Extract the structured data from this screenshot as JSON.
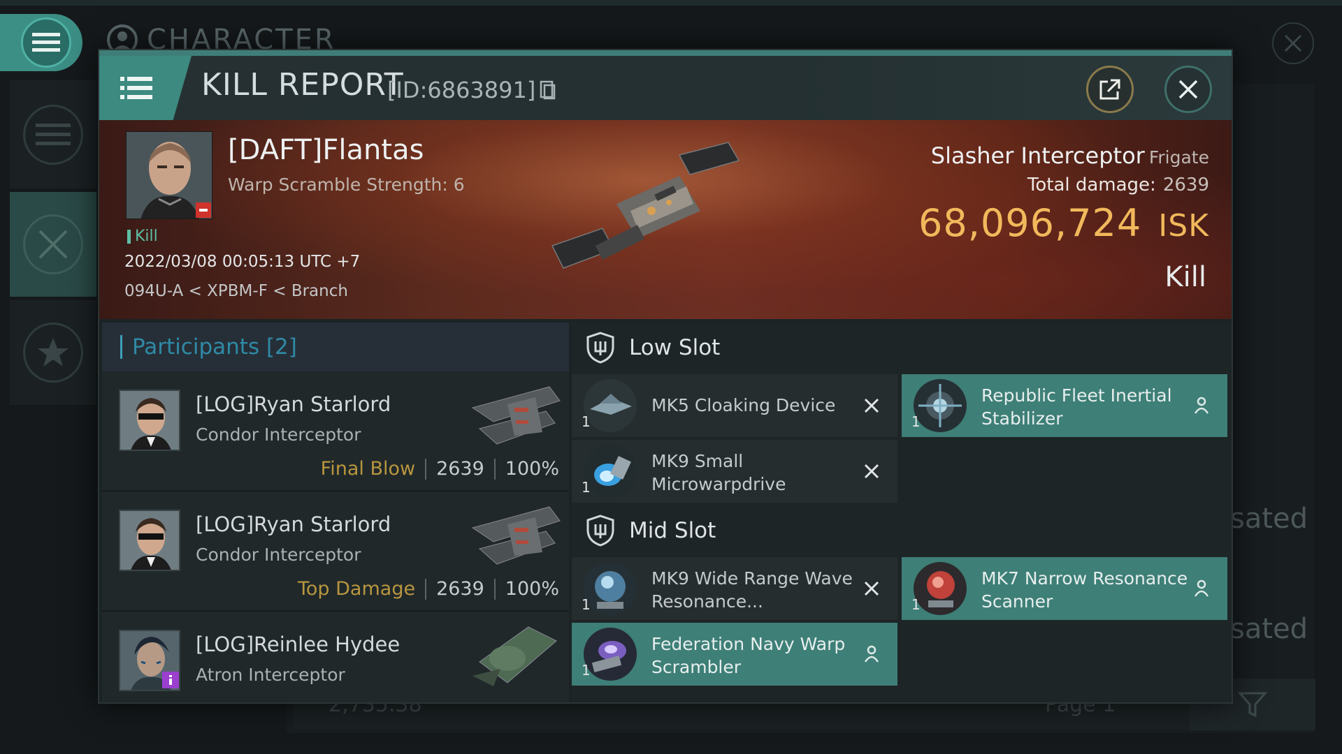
{
  "background": {
    "title": "CHARACTER",
    "sated_1": "sated",
    "sated_2": "sated",
    "balance": "2,735.38",
    "page": "Page 1"
  },
  "header": {
    "title": "KILL REPORT",
    "id_label": "[ID:6863891]",
    "icons": [
      "menu-icon",
      "copy-icon",
      "share-icon",
      "close-icon"
    ]
  },
  "victim": {
    "name": "[DAFT]Flantas",
    "warp_scramble": "Warp Scramble Strength: 6",
    "kill_tag": "Kill",
    "timestamp": "2022/03/08 00:05:13 UTC +7",
    "location": "094U-A < XPBM-F < Branch",
    "ship_name": "Slasher Interceptor",
    "ship_class": "Frigate",
    "damage_label": "Total damage:",
    "damage_value": "2639",
    "isk_value": "68,096,724",
    "isk_unit": "ISK",
    "result": "Kill"
  },
  "participants": {
    "title": "Participants [2]",
    "rows": [
      {
        "name": "[LOG]Ryan Starlord",
        "ship": "Condor Interceptor",
        "tag": "Final Blow",
        "damage": "2639",
        "percent": "100%"
      },
      {
        "name": "[LOG]Ryan Starlord",
        "ship": "Condor Interceptor",
        "tag": "Top Damage",
        "damage": "2639",
        "percent": "100%"
      },
      {
        "name": "[LOG]Reinlee Hydee",
        "ship": "Atron Interceptor",
        "tag": "",
        "damage": "",
        "percent": ""
      }
    ]
  },
  "fitting": {
    "low_slot_title": "Low Slot",
    "mid_slot_title": "Mid Slot",
    "items": [
      {
        "name": "MK5 Cloaking Device",
        "qty": "1",
        "status": "destroyed"
      },
      {
        "name": "Republic Fleet Inertial Stabilizer",
        "qty": "1",
        "status": "dropped"
      },
      {
        "name": "MK9 Small Microwarpdrive",
        "qty": "1",
        "status": "destroyed"
      },
      {
        "name": "MK9 Wide Range Wave Resonance...",
        "qty": "1",
        "status": "destroyed"
      },
      {
        "name": "MK7 Narrow Resonance Scanner",
        "qty": "1",
        "status": "dropped"
      },
      {
        "name": "Federation Navy Warp Scrambler",
        "qty": "1",
        "status": "dropped"
      }
    ]
  },
  "colors": {
    "accent_teal": "#3e7f77",
    "isk_gold": "#f2b95c",
    "final_blow": "#b8963f",
    "participants_blue": "#2f8aa6"
  }
}
